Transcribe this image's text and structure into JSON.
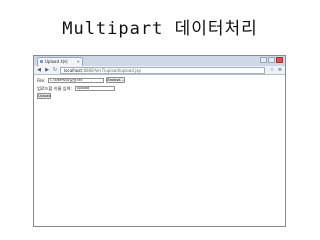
{
  "slide": {
    "title": "Multipart  데이터처리"
  },
  "browser": {
    "tab_title": "Upload 처리",
    "address_host": "localhost",
    "address_path": ":8080/Ver7/upload/upload.jsp",
    "back_glyph": "◀",
    "forward_glyph": "▶",
    "reload_glyph": "↻",
    "close_glyph": "×",
    "star_glyph": "☆",
    "menu_glyph": "≡"
  },
  "form": {
    "file_label": "File:",
    "file_value": "C:\\Users\\파일명.txt",
    "browse_label": "Browse...",
    "text_label": "업로드할 이름 입력:",
    "text_value": "upload",
    "submit_label": "Upload"
  }
}
